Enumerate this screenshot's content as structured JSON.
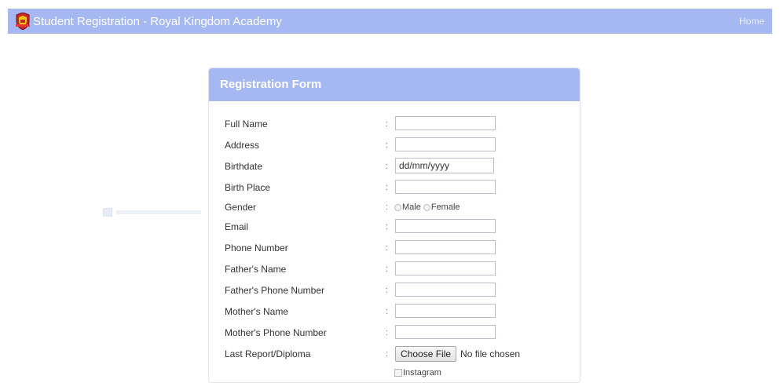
{
  "navbar": {
    "title": "Student Registration - Royal Kingdom Academy",
    "home_link": "Home"
  },
  "form": {
    "header": "Registration Form",
    "colon": ":",
    "fields": {
      "full_name": {
        "label": "Full Name",
        "value": ""
      },
      "address": {
        "label": "Address",
        "value": ""
      },
      "birthdate": {
        "label": "Birthdate",
        "value": "dd/mm/yyyy"
      },
      "birth_place": {
        "label": "Birth Place",
        "value": ""
      },
      "gender": {
        "label": "Gender",
        "options": [
          "Male",
          "Female"
        ]
      },
      "email": {
        "label": "Email",
        "value": ""
      },
      "phone_number": {
        "label": "Phone Number",
        "value": ""
      },
      "fathers_name": {
        "label": "Father's Name",
        "value": ""
      },
      "fathers_phone": {
        "label": "Father's Phone Number",
        "value": ""
      },
      "mothers_name": {
        "label": "Mother's Name",
        "value": ""
      },
      "mothers_phone": {
        "label": "Mother's Phone Number",
        "value": ""
      },
      "last_report": {
        "label": "Last Report/Diploma",
        "button_label": "Choose File",
        "status": "No file chosen"
      }
    },
    "social": {
      "label": "Instagram"
    }
  },
  "colors": {
    "accent": "#a6b8f2",
    "header_text": "#ffffff",
    "border": "#b9bec8"
  },
  "icons": {
    "logo": "academy-crest-icon"
  }
}
